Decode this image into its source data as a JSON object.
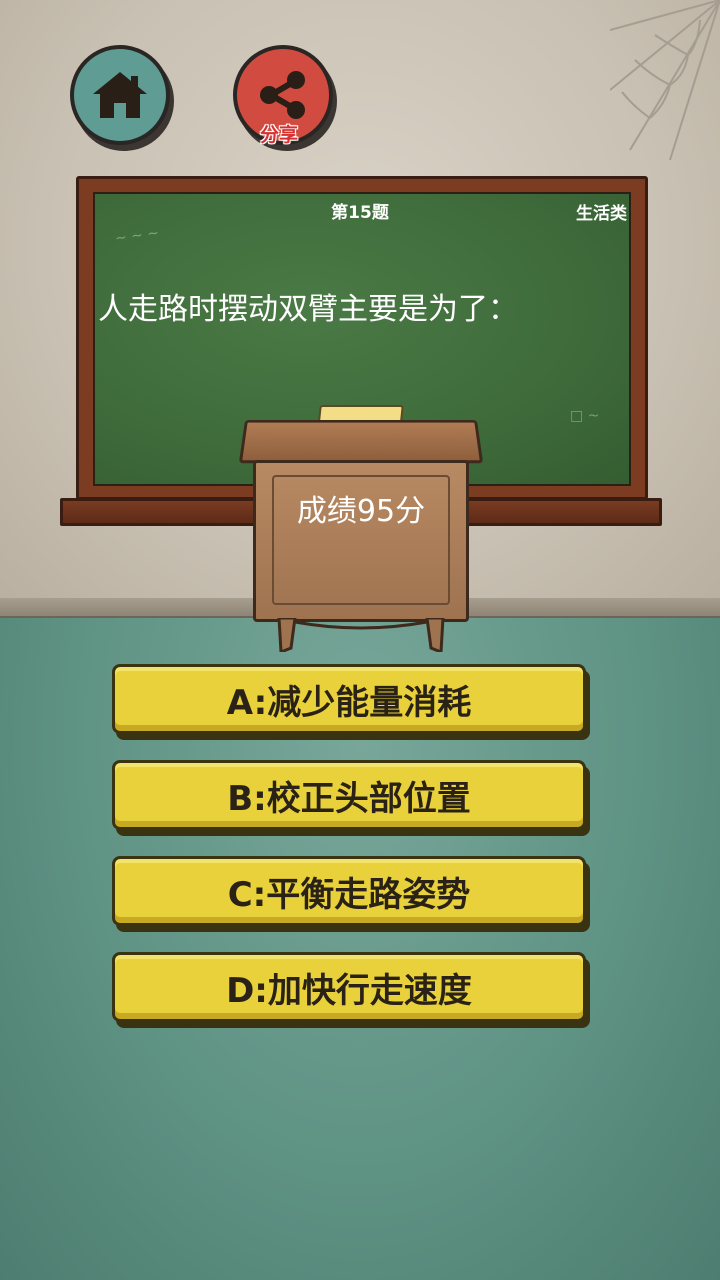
{
  "header": {
    "home_icon": "home-icon",
    "share_icon": "share-icon",
    "share_label": "分享",
    "colors": {
      "home": "#5f9c94",
      "share": "#d24b40"
    }
  },
  "board": {
    "question_number": "第15题",
    "category": "生活类",
    "question": "人走路时摆动双臂主要是为了："
  },
  "desk": {
    "score": "成绩95分"
  },
  "answers": [
    {
      "label": "A:减少能量消耗"
    },
    {
      "label": "B:校正头部位置"
    },
    {
      "label": "C:平衡走路姿势"
    },
    {
      "label": "D:加快行走速度"
    }
  ]
}
